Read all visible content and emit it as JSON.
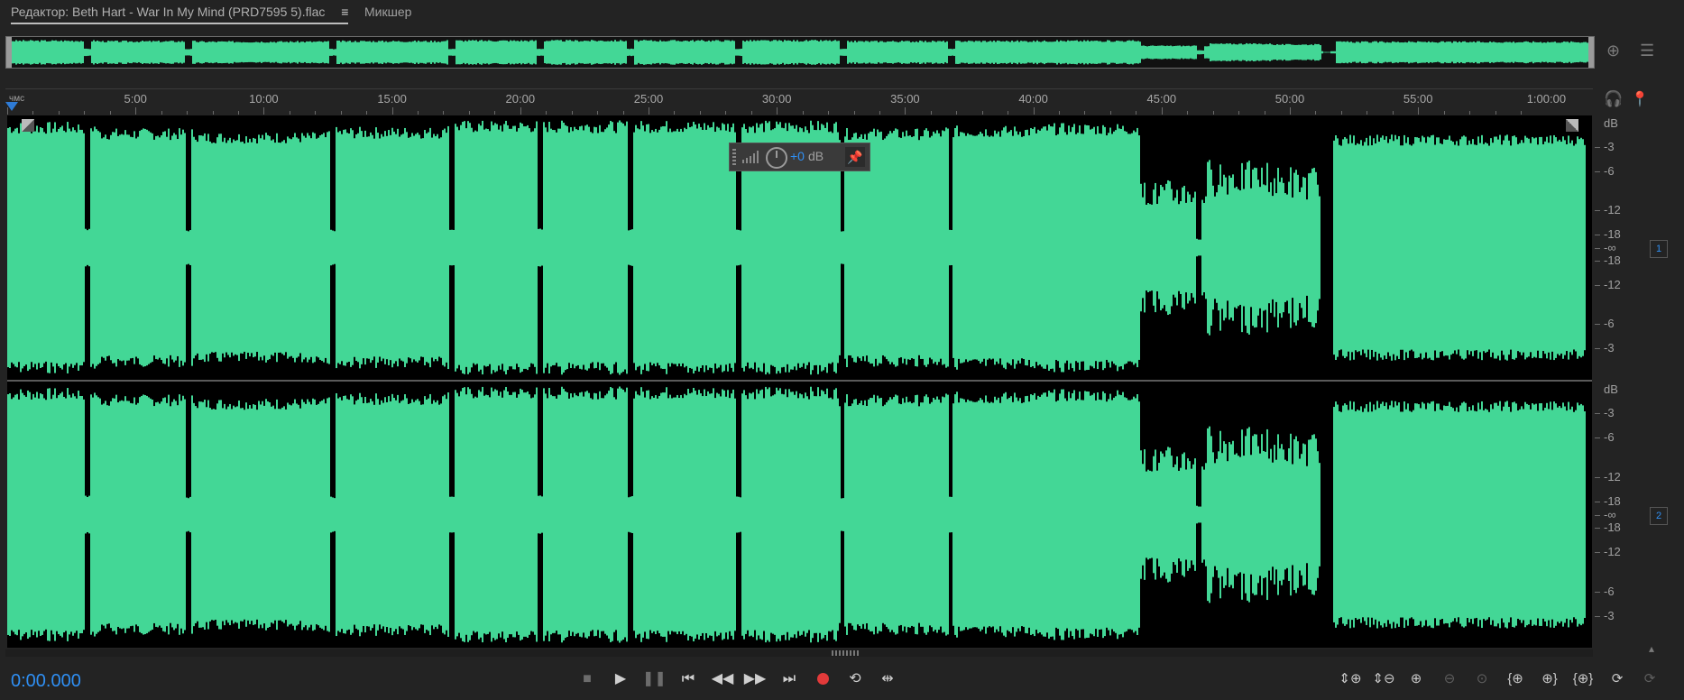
{
  "tabs": {
    "editor_label": "Редактор: Beth Hart - War In My Mind (PRD7595 5).flac",
    "menu_glyph": "≡",
    "mixer_label": "Микшер"
  },
  "ruler": {
    "format_label": "чмс",
    "ticks": [
      "5:00",
      "10:00",
      "15:00",
      "20:00",
      "25:00",
      "30:00",
      "35:00",
      "40:00",
      "45:00",
      "50:00",
      "55:00",
      "1:00:00"
    ]
  },
  "hud": {
    "value": "+0",
    "unit": "dB"
  },
  "db_scale": {
    "labels": [
      "dB",
      "-3",
      "-6",
      "-12",
      "-18",
      "-∞",
      "-18",
      "-12",
      "-6",
      "-3"
    ]
  },
  "channels": [
    "1",
    "2"
  ],
  "transport": {
    "timecode": "0:00.000"
  },
  "colors": {
    "waveform": "#43d796",
    "background": "#232323",
    "accent_blue": "#2f8ff3",
    "record_red": "#e23a3a"
  },
  "icons": {
    "stop": "stop-icon",
    "play": "play-icon",
    "pause": "pause-icon",
    "prev": "skip-back-icon",
    "rewind": "rewind-icon",
    "forward": "fast-forward-icon",
    "next": "skip-forward-icon",
    "record": "record-icon",
    "loop": "loop-icon",
    "skip_selection": "skip-selection-icon"
  }
}
